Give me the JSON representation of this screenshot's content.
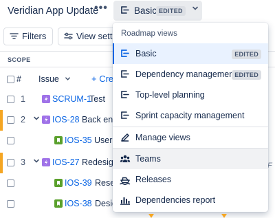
{
  "header": {
    "title": "Veridian App Update",
    "more_label": "•••",
    "view_label": "Basic",
    "view_badge": "EDITED",
    "chevron": "⌄"
  },
  "toolbar": {
    "filters_label": "Filters",
    "view_settings_label": "View settings"
  },
  "table": {
    "scope_label": "SCOPE",
    "col_hash": "#",
    "col_issue": "Issue",
    "create_label": "+ Create",
    "rows": [
      {
        "num": "1",
        "key": "SCRUM-1",
        "summary": "Test",
        "type": "epic"
      },
      {
        "num": "2",
        "key": "IOS-28",
        "summary": "Back end",
        "type": "epic",
        "expander": "⌄"
      },
      {
        "num": "",
        "key": "IOS-35",
        "summary": "User",
        "type": "story"
      },
      {
        "num": "3",
        "key": "IOS-27",
        "summary": "Redesign",
        "type": "epic",
        "expander": "⌄"
      },
      {
        "num": "",
        "key": "IOS-39",
        "summary": "Resea",
        "type": "story"
      },
      {
        "num": "",
        "key": "IOS-38",
        "summary": "Desig",
        "type": "story"
      }
    ],
    "right_fragment": "/F"
  },
  "menu": {
    "heading": "Roadmap views",
    "items": [
      {
        "label": "Basic",
        "badge": "EDITED",
        "icon": "roadmap-basic-icon"
      },
      {
        "label": "Dependency management",
        "badge": "EDITED",
        "icon": "dependency-icon"
      },
      {
        "label": "Top-level planning",
        "icon": "top-level-icon"
      },
      {
        "label": "Sprint capacity management",
        "icon": "sprint-capacity-icon"
      },
      {
        "label": "Manage views",
        "icon": "pencil-icon"
      },
      {
        "label": "Teams",
        "icon": "people-icon"
      },
      {
        "label": "Releases",
        "icon": "ship-icon"
      },
      {
        "label": "Dependencies report",
        "icon": "bar-chart-icon"
      }
    ]
  },
  "colors": {
    "accent": "#0c66e4",
    "epic": "#9f72e8",
    "story": "#5aa02c",
    "marker": "#f5a623"
  }
}
